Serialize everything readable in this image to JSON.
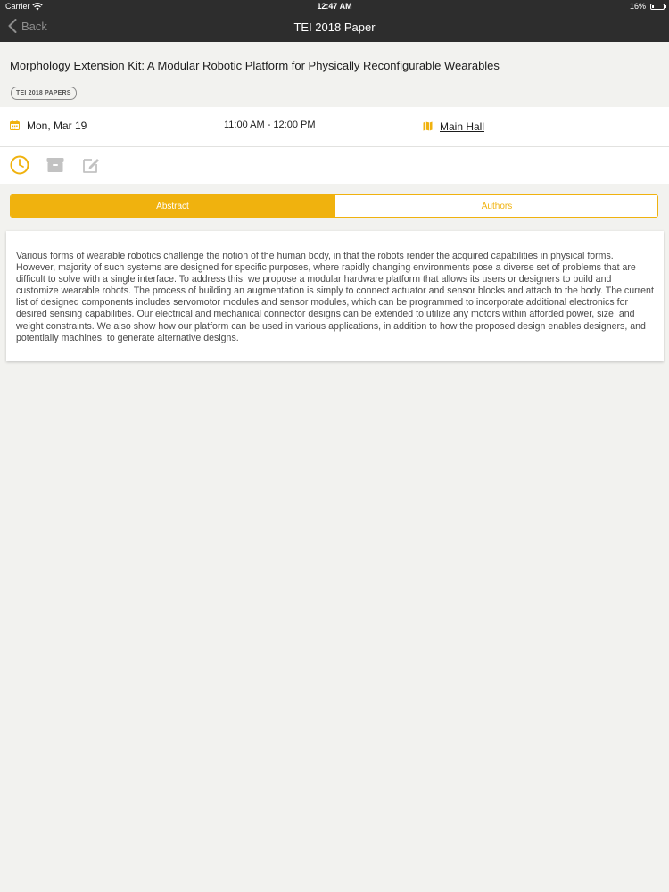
{
  "status_bar": {
    "carrier": "Carrier",
    "time": "12:47 AM",
    "battery": "16%",
    "battery_level": 0.16
  },
  "nav": {
    "back_label": "Back",
    "title": "TEI 2018 Paper"
  },
  "paper": {
    "title": "Morphology Extension Kit: A Modular Robotic Platform for Physically Reconfigurable Wearables",
    "tag": "TEI 2018 PAPERS"
  },
  "info": {
    "date": "Mon, Mar 19",
    "time": "11:00 AM - 12:00 PM",
    "location": "Main Hall"
  },
  "actions": [
    "clock-icon",
    "archive-icon",
    "edit-icon"
  ],
  "tabs": {
    "abstract_label": "Abstract",
    "authors_label": "Authors"
  },
  "abstract": "Various forms of wearable robotics challenge the notion of the human body, in that the robots render the acquired capabilities in physical forms. However, majority of such systems are designed for specific purposes, where rapidly changing environments pose a diverse set of problems that are difficult to solve with a single interface. To address this, we propose a modular hardware platform that allows its users or designers to build and customize wearable robots. The process of building an augmentation is simply to connect actuator and sensor blocks and attach to the body. The current list of designed components includes servomotor modules and sensor modules, which can be programmed to incorporate additional electronics for desired sensing capabilities. Our electrical and mechanical connector designs can be extended to utilize any motors within afforded power, size, and weight constraints. We also show how our platform can be used in various applications, in addition to how the proposed design enables designers, and potentially machines, to generate alternative designs.",
  "colors": {
    "accent": "#f0b20e",
    "header_bg": "#2d2d2d",
    "page_bg": "#f2f2ef"
  }
}
